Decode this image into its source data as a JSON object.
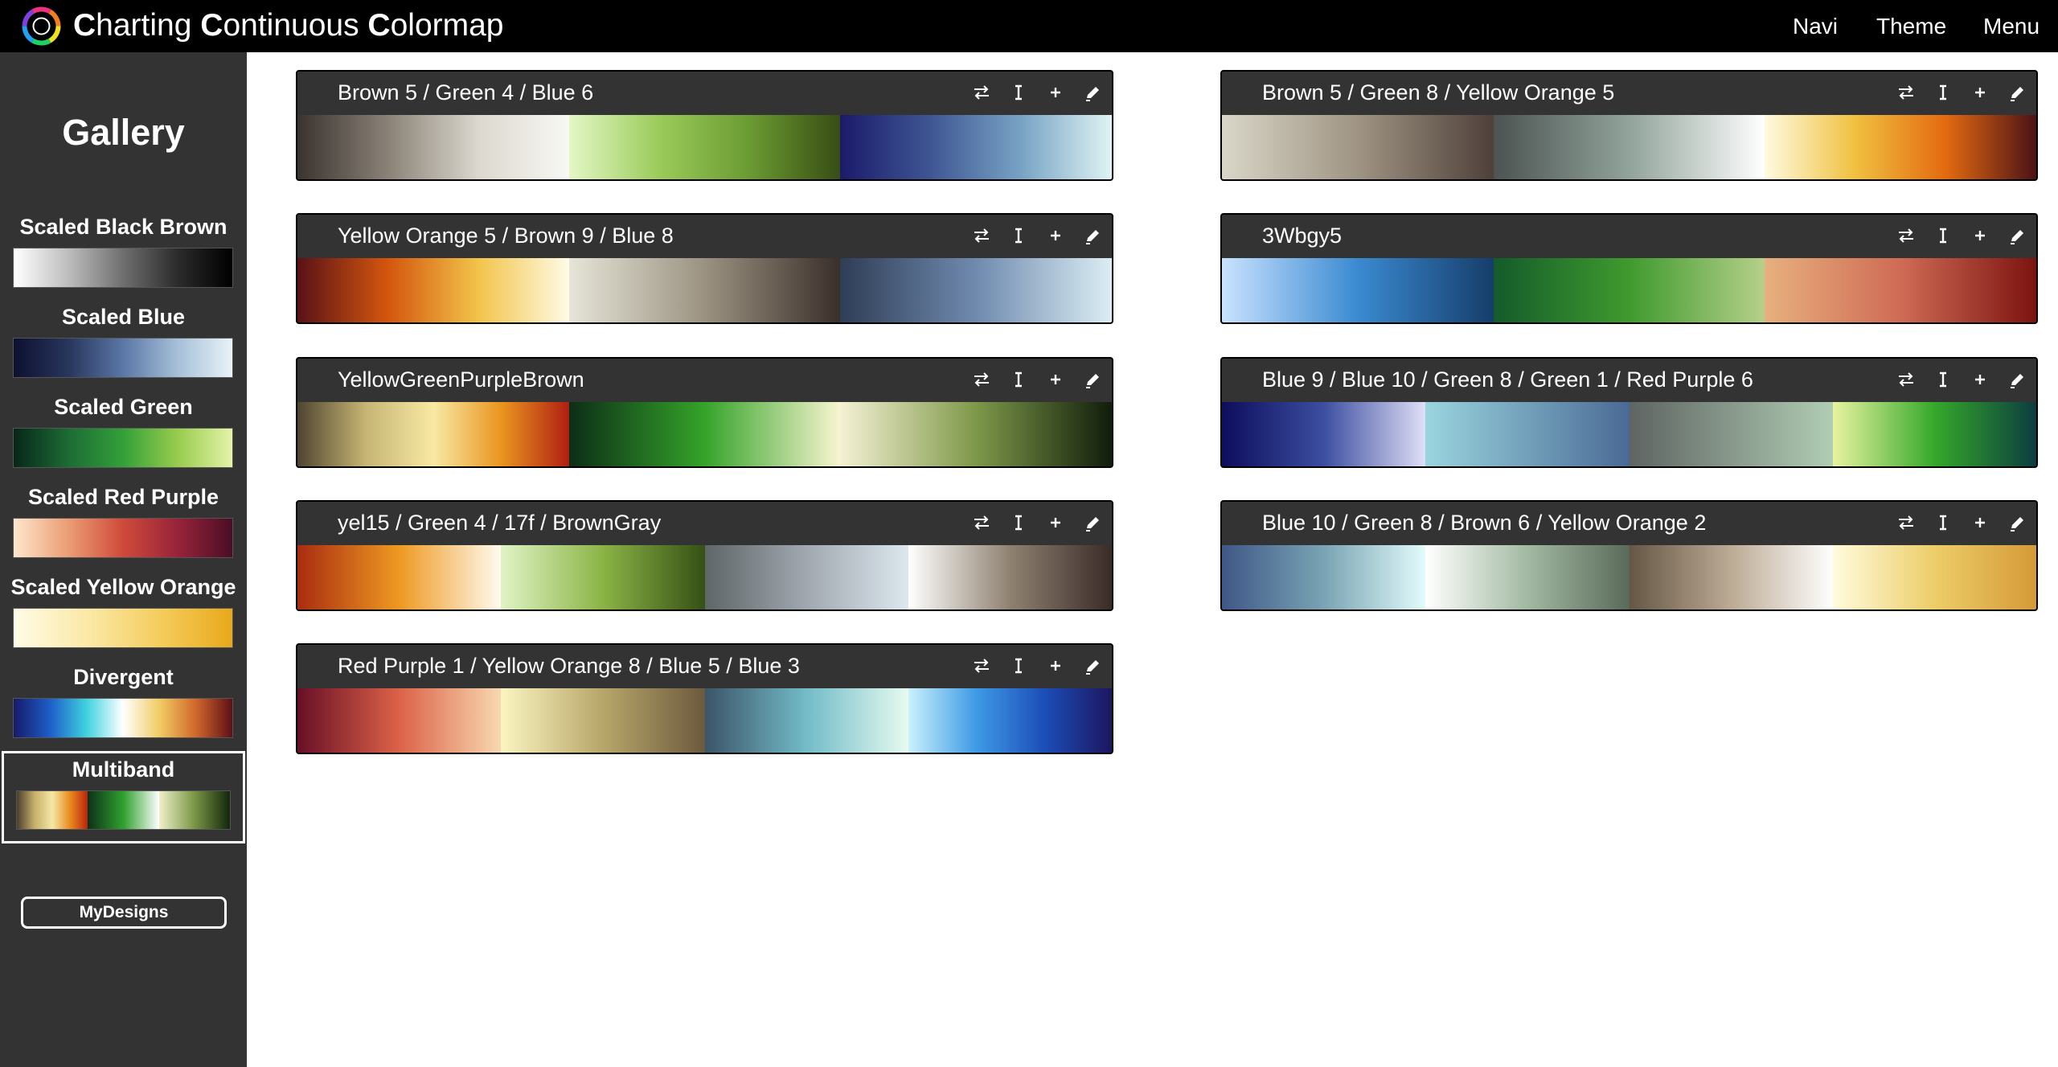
{
  "header": {
    "logo_icon": "rainbow-ring-logo-icon",
    "title_parts": [
      {
        "initial": "C",
        "rest": "harting "
      },
      {
        "initial": "C",
        "rest": "ontinuous "
      },
      {
        "initial": "C",
        "rest": "olormap"
      }
    ],
    "nav": {
      "navi": "Navi",
      "theme": "Theme",
      "menu": "Menu"
    }
  },
  "sidebar": {
    "title": "Gallery",
    "items": [
      {
        "label": "Scaled Black Brown",
        "gradient": [
          "#ffffff",
          "#bdbdbd",
          "#6f6f6f",
          "#2b2b2b",
          "#000000"
        ],
        "active": false
      },
      {
        "label": "Scaled Blue",
        "gradient": [
          "#0d1030",
          "#28365c",
          "#5a77a6",
          "#a6c0d8",
          "#e8f3f8"
        ],
        "active": false
      },
      {
        "label": "Scaled Green",
        "gradient": [
          "#07271a",
          "#1d6b35",
          "#33a039",
          "#98cc4e",
          "#e4f3a8"
        ],
        "active": false
      },
      {
        "label": "Scaled Red Purple",
        "gradient": [
          "#fde6cc",
          "#eb9d74",
          "#cf4a3a",
          "#982339",
          "#4a0e26"
        ],
        "active": false
      },
      {
        "label": "Scaled Yellow Orange",
        "gradient": [
          "#fffbe6",
          "#fbe9a8",
          "#f5cd5e",
          "#e8a81a"
        ],
        "active": false
      },
      {
        "label": "Divergent",
        "gradient": [
          "#161b6b",
          "#1d5ec7",
          "#3fd2df",
          "#ffffff",
          "#f1cc64",
          "#d0672b",
          "#5e0f17"
        ],
        "active": false
      },
      {
        "label": "Multiband",
        "bands": [
          [
            "#4b3f2e",
            "#c7b06a",
            "#f4e7a6",
            "#ea8c20",
            "#b9230e"
          ],
          [
            "#0d3118",
            "#30a12e",
            "#ffffff"
          ],
          [
            "#eff0c9",
            "#7a9645",
            "#12260d"
          ]
        ],
        "active": true
      }
    ],
    "mydesigns_label": "MyDesigns"
  },
  "cards": [
    {
      "title": "Brown 5 / Green 4 / Blue 6",
      "bands": [
        [
          "#3a332f",
          "#8a8277",
          "#dcd8cf",
          "#f8f8f4"
        ],
        [
          "#e4f7c6",
          "#9acb5a",
          "#6a9a32",
          "#384d14"
        ],
        [
          "#1b1a6a",
          "#3f5693",
          "#78a3c4",
          "#dff4f4"
        ]
      ]
    },
    {
      "title": "Brown 5 / Green 8 / Yellow Orange 5",
      "bands": [
        [
          "#d9d6c8",
          "#9f9483",
          "#4e4039"
        ],
        [
          "#4c5352",
          "#91a39a",
          "#ffffff"
        ],
        [
          "#fffbe0",
          "#f0c040",
          "#e36a10",
          "#4c1216"
        ]
      ]
    },
    {
      "title": "Yellow Orange 5 / Brown 9 / Blue 8",
      "bands": [
        [
          "#5a1216",
          "#d4560e",
          "#f2c44a",
          "#fffbe6"
        ],
        [
          "#e6e5d8",
          "#9b9281",
          "#3a2f2a"
        ],
        [
          "#2f3d56",
          "#6f8aae",
          "#dceef4"
        ]
      ]
    },
    {
      "title": "3Wbgy5",
      "bands": [
        [
          "#c9e2ff",
          "#3a8ad1",
          "#163d6a"
        ],
        [
          "#145b2a",
          "#3f9a2e",
          "#b6d08a"
        ],
        [
          "#e7b07e",
          "#cf6b55",
          "#7c1310"
        ]
      ]
    },
    {
      "title": "YellowGreenPurpleBrown",
      "bands": [
        [
          "#4f4530",
          "#c6b574",
          "#f7e9a4",
          "#ea951f",
          "#b01f12"
        ],
        [
          "#0c2e17",
          "#35a32a",
          "#f8f5d0"
        ],
        [
          "#f4f1d4",
          "#7e9849",
          "#101d0b"
        ]
      ]
    },
    {
      "title": "Blue 9 / Blue 10 / Green 8 / Green 1 / Red Purple 6",
      "bands": [
        [
          "#0d0d5c",
          "#3c4ea0",
          "#dfdff6"
        ],
        [
          "#9ad5de",
          "#4a6a95"
        ],
        [
          "#5e6462",
          "#b1cdb4"
        ],
        [
          "#e8f3a0",
          "#35a82a",
          "#0c3d3f"
        ]
      ]
    },
    {
      "title": "yel15 / Green 4 / 17f / BrownGray",
      "bands": [
        [
          "#a82c10",
          "#ee9922",
          "#fffbf0"
        ],
        [
          "#e1f3c6",
          "#8ab445",
          "#365016"
        ],
        [
          "#5e6668",
          "#a1a8b0",
          "#dce7ee"
        ],
        [
          "#ffffff",
          "#8e8170",
          "#3a2b28"
        ]
      ]
    },
    {
      "title": "Blue 10 / Green 8 / Brown 6 / Yellow Orange 2",
      "bands": [
        [
          "#3f5787",
          "#79a4b3",
          "#e2fbfb"
        ],
        [
          "#ffffff",
          "#a2b9a2",
          "#5a6a5a"
        ],
        [
          "#655745",
          "#bcab95",
          "#ffffff"
        ],
        [
          "#fffbde",
          "#eccd68",
          "#d59a38"
        ]
      ]
    },
    {
      "title": "Red Purple 1 / Yellow Orange 8 / Blue 5 / Blue 3",
      "bands": [
        [
          "#680f26",
          "#dc6248",
          "#f8d8b0"
        ],
        [
          "#fbf5c0",
          "#b7a66a",
          "#6c5a3d"
        ],
        [
          "#3b5468",
          "#73bcc8",
          "#e6fbf0"
        ],
        [
          "#c9f1fb",
          "#3f9ae5",
          "#1c4eb8",
          "#1d1560"
        ]
      ]
    }
  ],
  "icons": {
    "swap": "swap-arrows-icon",
    "text": "text-cursor-icon",
    "add": "plus-icon",
    "edit": "pencil-icon"
  }
}
